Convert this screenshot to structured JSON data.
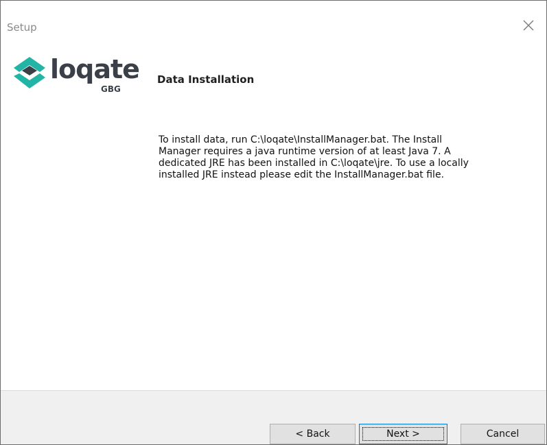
{
  "window": {
    "title": "Setup"
  },
  "logo": {
    "brand": "loqate",
    "sub": "GBG",
    "colors": {
      "accent": "#22b5a5",
      "text": "#3a3f48"
    }
  },
  "page": {
    "heading": "Data Installation",
    "body": "To install data, run C:\\loqate\\InstallManager.bat. The Install\nManager requires a java runtime version of at least Java 7. A\ndedicated JRE has been installed in C:\\loqate\\jre. To use a locally\ninstalled JRE instead please edit the InstallManager.bat file."
  },
  "buttons": {
    "back": "< Back",
    "next": "Next >",
    "cancel": "Cancel"
  }
}
